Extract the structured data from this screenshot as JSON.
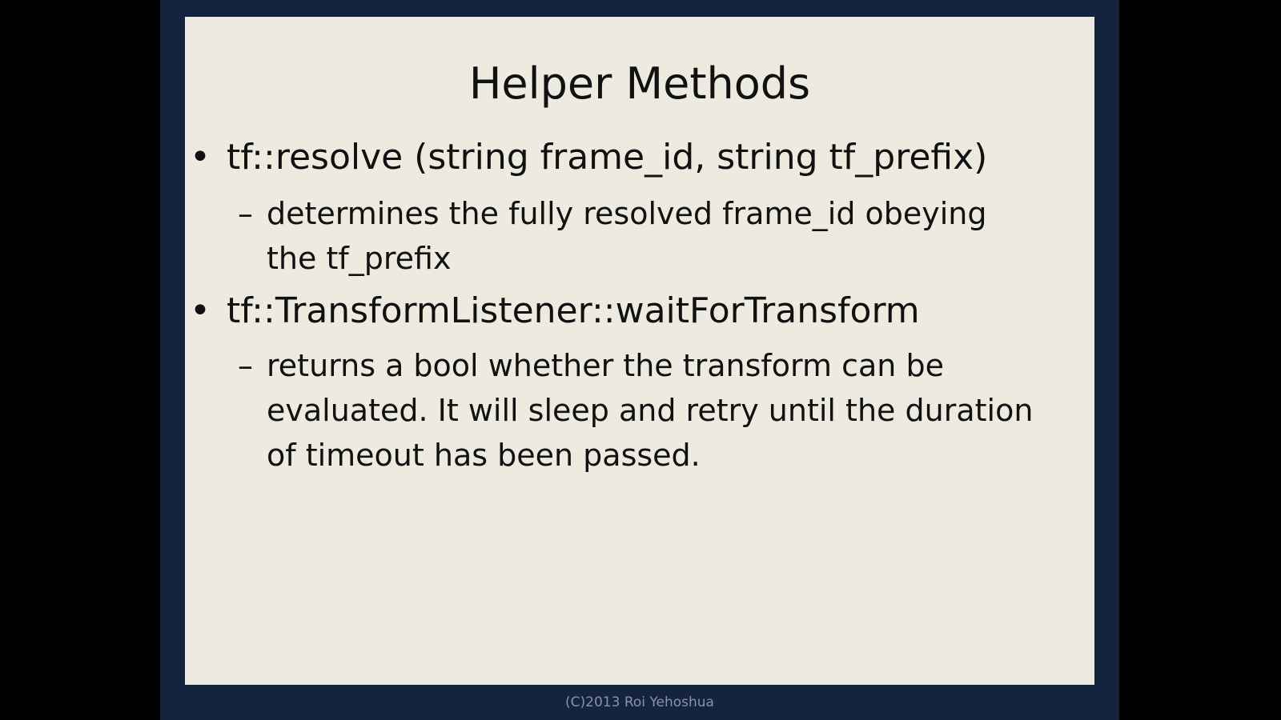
{
  "slide": {
    "title": "Helper Methods",
    "bullets": [
      {
        "marker": "•",
        "text": "tf::resolve (string frame_id, string tf_prefix)",
        "sub": {
          "marker": "–",
          "text": "determines the fully resolved frame_id obeying the tf_prefix"
        }
      },
      {
        "marker": "•",
        "text": "tf::TransformListener::waitForTransform",
        "sub": {
          "marker": "–",
          "text": "returns a bool whether the transform can be evaluated. It will sleep and retry until the duration of timeout has been passed."
        }
      }
    ]
  },
  "footer": {
    "text": "(C)2013 Roi Yehoshua"
  },
  "colors": {
    "outer_background": "#000000",
    "frame": "#14233e",
    "panel": "#edebe0",
    "text": "#111111",
    "footer_text": "#8b93a3"
  }
}
